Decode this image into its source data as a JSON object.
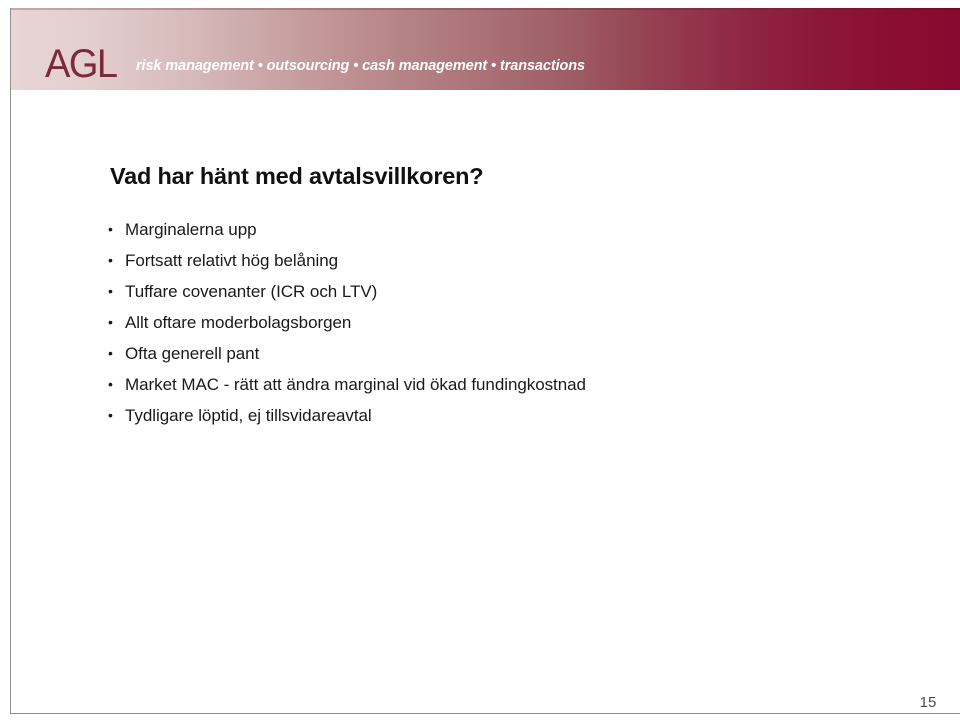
{
  "header": {
    "logo_text": "AGL",
    "tagline": "risk management • outsourcing • cash management • transactions",
    "gradient_start_color": "#E7D6D5",
    "gradient_end_color": "#890A30",
    "logo_color": "#7C2A39",
    "tagline_color": "#FFFFFF"
  },
  "slide": {
    "title": "Vad har hänt med avtalsvillkoren?",
    "title_color": "#111111",
    "bullet_glyph": "•",
    "bullets": [
      {
        "text": "Marginalerna upp"
      },
      {
        "text": "Fortsatt relativt hög belåning"
      },
      {
        "text": "Tuffare covenanter (ICR och LTV)"
      },
      {
        "text": "Allt oftare moderbolagsborgen"
      },
      {
        "text": "Ofta generell pant"
      },
      {
        "text": "Market MAC - rätt att ändra marginal vid ökad fundingkostnad"
      },
      {
        "text": "Tydligare löptid, ej tillsvidareavtal"
      }
    ],
    "page_number": "15",
    "page_number_color": "#4C4C4C",
    "background_color": "#FFFFFF",
    "border_color": "#909090"
  }
}
